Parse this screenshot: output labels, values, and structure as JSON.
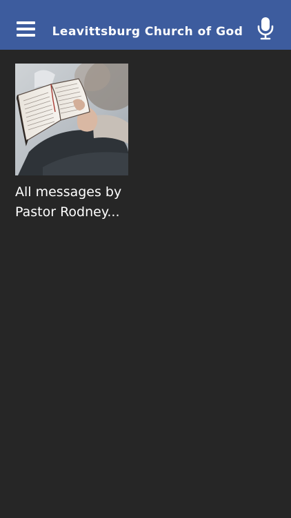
{
  "header": {
    "title": "Leavittsburg Church of God",
    "menu_icon": "hamburger-menu-icon",
    "mic_icon": "microphone-icon",
    "background_color": "#3d5c9e"
  },
  "content": {
    "background_color": "#262626",
    "items": [
      {
        "title": "All messages by Pastor Rodney...",
        "thumbnail": "person-reading-bible-image"
      }
    ]
  }
}
